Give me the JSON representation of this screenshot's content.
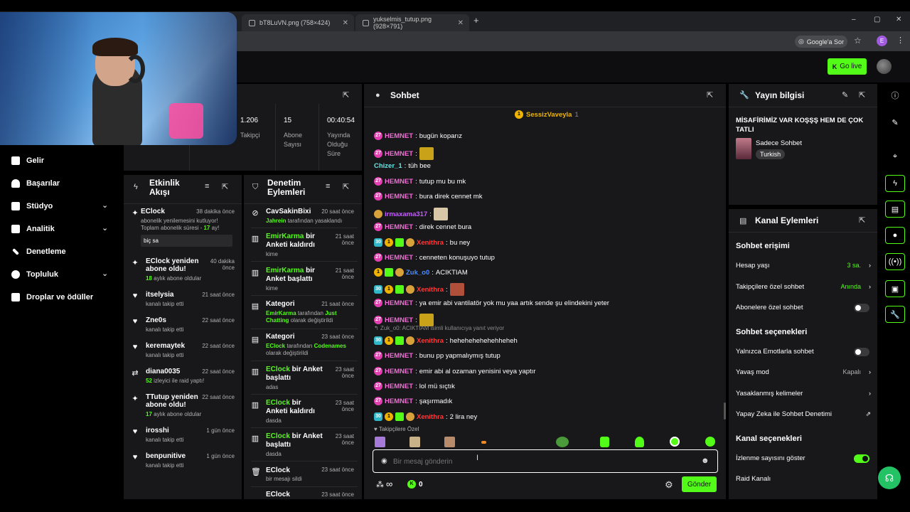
{
  "browser": {
    "tabs": [
      {
        "title": "bT8LuVN.png (758×424)"
      },
      {
        "title": "yukselmis_tutup.png (928×791)"
      }
    ],
    "new_tab": "+",
    "google_pill": "Google'a Sor",
    "profile_letter": "E",
    "window_controls": [
      "–",
      "▢",
      "✕"
    ]
  },
  "header": {
    "go_live": "Go live"
  },
  "nav": {
    "items": [
      {
        "label": "Gelir",
        "icon": "chart-icon",
        "chevron": false
      },
      {
        "label": "Başarılar",
        "icon": "trophy-icon",
        "chevron": false
      },
      {
        "label": "Stüdyo",
        "icon": "studio-icon",
        "chevron": true
      },
      {
        "label": "Analitik",
        "icon": "analytics-icon",
        "chevron": true
      },
      {
        "label": "Denetleme",
        "icon": "wrench-icon",
        "chevron": false
      },
      {
        "label": "Topluluk",
        "icon": "users-icon",
        "chevron": true
      },
      {
        "label": "Droplar ve ödüller",
        "icon": "gift-icon",
        "chevron": false
      }
    ]
  },
  "stats": [
    {
      "value": "1.206",
      "label": "Takipçi"
    },
    {
      "value": "15",
      "label": "Abone Sayısı"
    },
    {
      "value": "00:40:54",
      "label": "Yayında Olduğu Süre"
    }
  ],
  "activity": {
    "title": "Etkinlik Akışı",
    "items": [
      {
        "name": "EClock",
        "time": "38 dakika önce",
        "line1": "abonelik yenilemesini kutluyor!",
        "line2a": "Toplam abonelik süresi - ",
        "line2b": "17",
        "line2c": " ay!",
        "message": "biç sa"
      },
      {
        "name": "EClock yeniden abone oldu!",
        "time": "40 dakika önce",
        "num": "18",
        "sub": " aylık abone oldular"
      },
      {
        "name": "itselysia",
        "time": "21 saat önce",
        "sub": "kanalı takip etti"
      },
      {
        "name": "Zne0s",
        "time": "22 saat önce",
        "sub": "kanalı takip etti"
      },
      {
        "name": "keremaytek",
        "time": "22 saat önce",
        "sub": "kanalı takip etti"
      },
      {
        "name": "diana0035",
        "time": "22 saat önce",
        "num": "52",
        "sub": " izleyici ile raid yaptı!"
      },
      {
        "name": "TTutup yeniden abone oldu!",
        "time": "22 saat önce",
        "num": "17",
        "sub": " aylık abone oldular"
      },
      {
        "name": "irosshi",
        "time": "1 gün önce",
        "sub": "kanalı takip etti"
      },
      {
        "name": "benpunitive",
        "time": "1 gün önce",
        "sub": "kanalı takip etti"
      }
    ]
  },
  "moderation": {
    "title": "Denetim Eylemleri",
    "items": [
      {
        "title": "CavSakinBixi",
        "time": "20 saat önce",
        "g": "Jahrein",
        "sub": " tarafından yasaklandı"
      },
      {
        "g": "EmirKarma",
        "title": " bir Anketi kaldırdı",
        "time": "21 saat önce",
        "sub": "kime"
      },
      {
        "g": "EmirKarma",
        "title": " bir Anket başlattı",
        "time": "21 saat önce",
        "sub": "kime"
      },
      {
        "title": "Kategori",
        "time": "21 saat önce",
        "g": "EmirKarma",
        "sub": " tarafından ",
        "g2": "Just Chatting",
        "sub2": " olarak değiştirildi"
      },
      {
        "title": "Kategori",
        "time": "23 saat önce",
        "g": "EClock",
        "sub": " tarafından ",
        "g2": "Codenames",
        "sub2": " olarak değiştirildi"
      },
      {
        "g": "EClock",
        "title": " bir Anket başlattı",
        "time": "23 saat önce",
        "sub": "adas"
      },
      {
        "g": "EClock",
        "title": " bir Anketi kaldırdı",
        "time": "23 saat önce",
        "sub": "dasda"
      },
      {
        "g": "EClock",
        "title": " bir Anket başlattı",
        "time": "23 saat önce",
        "sub": "dasda"
      },
      {
        "title": "EClock",
        "time": "23 saat önce",
        "sub": "bir mesajı sildi"
      },
      {
        "title": "EClock",
        "time": "23 saat önce",
        "sub": ""
      }
    ]
  },
  "chat": {
    "title": "Sohbet",
    "pinned_user": "SessizVaveyla",
    "pinned_count": "1",
    "messages": [
      {
        "user": "HEMNET",
        "color": "pink",
        "badges": [
          "27"
        ],
        "text": "bugün koparız"
      },
      {
        "user": "HEMNET",
        "color": "pink",
        "badges": [
          "27"
        ],
        "text": "",
        "emote": "#c9a21a"
      },
      {
        "user": "Chizer_1",
        "color": "cyan",
        "badges": [],
        "text": "tüh bee"
      },
      {
        "user": "HEMNET",
        "color": "pink",
        "badges": [
          "27"
        ],
        "text": "tutup mu bu mk"
      },
      {
        "user": "HEMNET",
        "color": "pink",
        "badges": [
          "27"
        ],
        "text": "bura direk cennet mk"
      },
      {
        "user": "irmaxama317",
        "color": "purple",
        "badges": [
          "k"
        ],
        "text": "",
        "emote": "#d9c8a8"
      },
      {
        "user": "HEMNET",
        "color": "pink",
        "badges": [
          "27"
        ],
        "text": "direk cennet bura"
      },
      {
        "user": "Xenithra",
        "color": "red",
        "badges": [
          "30",
          "1",
          "g",
          "k"
        ],
        "text": "bu ney"
      },
      {
        "user": "HEMNET",
        "color": "pink",
        "badges": [
          "27"
        ],
        "text": "cenneten konuşuyo tutup"
      },
      {
        "user": "Zuk_o0",
        "color": "blue",
        "badges": [
          "1",
          "g",
          "k"
        ],
        "text": "ACIKTIAM"
      },
      {
        "user": "Xenithra",
        "color": "red",
        "badges": [
          "30",
          "1",
          "g",
          "k"
        ],
        "text": "",
        "emote": "#b0503a"
      },
      {
        "user": "HEMNET",
        "color": "pink",
        "badges": [
          "27"
        ],
        "text": "ya emir abi vantilatör yok mu yaa artık sende şu elindekini yeter"
      },
      {
        "user": "HEMNET",
        "color": "pink",
        "badges": [
          "27"
        ],
        "text": "",
        "emote": "#c9a21a"
      },
      {
        "reply": "Zuk_o0: ACIKTIAM isimli kullanıcıya yanıt veriyor",
        "user": "Xenithra",
        "color": "red",
        "badges": [
          "30",
          "1",
          "g",
          "k"
        ],
        "text": "hehehehehehehheheh"
      },
      {
        "user": "HEMNET",
        "color": "pink",
        "badges": [
          "27"
        ],
        "text": "bunu pp yapmalıymış tutup"
      },
      {
        "user": "HEMNET",
        "color": "pink",
        "badges": [
          "27"
        ],
        "text": "emir abi al ozaman yenisini veya yaptır"
      },
      {
        "user": "HEMNET",
        "color": "pink",
        "badges": [
          "27"
        ],
        "text": "lol mü sıçtık"
      },
      {
        "user": "HEMNET",
        "color": "pink",
        "badges": [
          "27"
        ],
        "text": "şaşırmadık"
      },
      {
        "user": "Xenithra",
        "color": "red",
        "badges": [
          "30",
          "1",
          "g",
          "k"
        ],
        "text": "2 lira ney"
      }
    ],
    "emote_section": "Takipçilere Özel",
    "input_placeholder": "Bir mesaj gönderin",
    "infinity": "∞",
    "points": "0",
    "send": "Gönder"
  },
  "info": {
    "title": "Yayın bilgisi",
    "stream_title": "MİSAFİRİMİZ VAR KOŞŞŞ HEM DE ÇOK TATLI",
    "category": "Sadece Sohbet",
    "language": "Turkish"
  },
  "channel_actions": {
    "title": "Kanal Eylemleri",
    "chat_access": "Sohbet erişimi",
    "account_age_label": "Hesap yaşı",
    "account_age_value": "3 sa.",
    "followers_only_label": "Takipçilere özel sohbet",
    "followers_only_value": "Anında",
    "subs_only_label": "Abonelere özel sohbet",
    "chat_options": "Sohbet seçenekleri",
    "emote_only_label": "Yalnızca Emotlarla sohbet",
    "slow_mode_label": "Yavaş mod",
    "slow_mode_value": "Kapalı",
    "banned_words_label": "Yasaklanmış kelimeler",
    "ai_mod_label": "Yapay Zeka ile Sohbet Denetimi",
    "channel_options": "Kanal seçenekleri",
    "viewer_count_label": "İzlenme sayısını göster",
    "raid_label": "Raid Kanalı"
  }
}
